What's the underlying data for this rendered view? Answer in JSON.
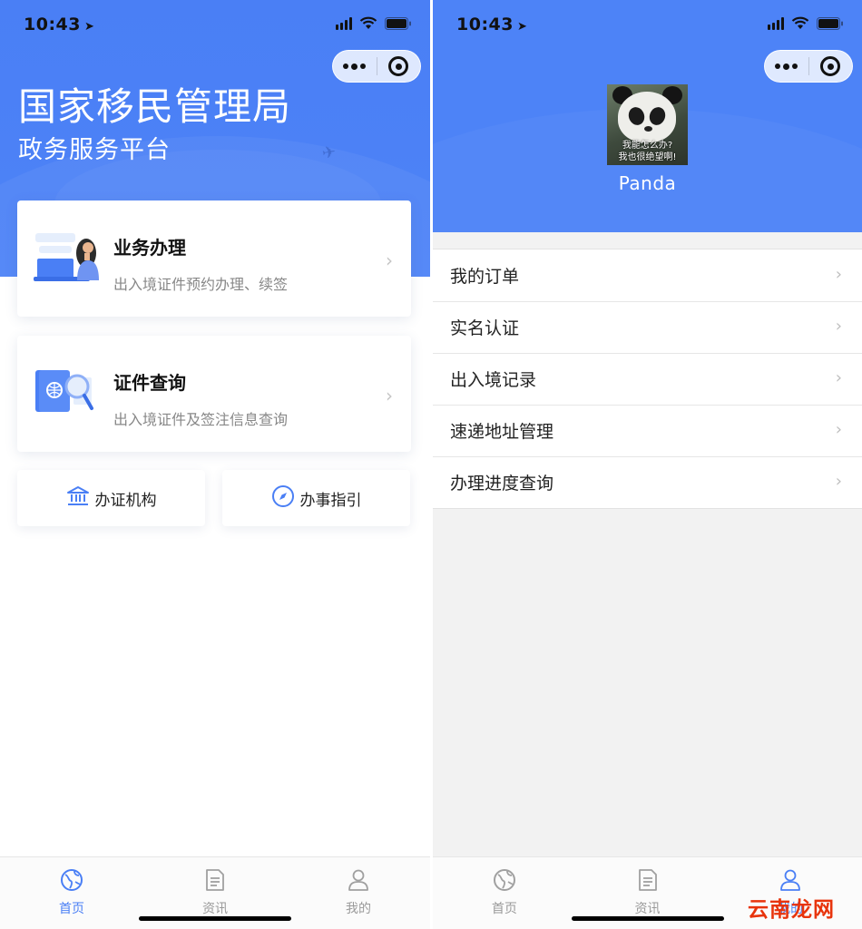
{
  "colors": {
    "brand_blue": "#4d83f7",
    "accent": "#4a7ff5",
    "watermark": "#e8340c"
  },
  "left_screen": {
    "status": {
      "time": "10:43"
    },
    "header": {
      "title": "国家移民管理局",
      "subtitle": "政务服务平台"
    },
    "cards": [
      {
        "title": "业务办理",
        "desc": "出入境证件预约办理、续签",
        "icon": "laptop-woman-illustration"
      },
      {
        "title": "证件查询",
        "desc": "出入境证件及签注信息查询",
        "icon": "passport-search-illustration"
      }
    ],
    "shortcuts": [
      {
        "label": "办证机构",
        "icon": "bank-building-icon"
      },
      {
        "label": "办事指引",
        "icon": "compass-icon"
      }
    ],
    "tabs": [
      {
        "label": "首页",
        "icon": "globe-icon",
        "active": true
      },
      {
        "label": "资讯",
        "icon": "document-icon",
        "active": false
      },
      {
        "label": "我的",
        "icon": "person-icon",
        "active": false
      }
    ]
  },
  "right_screen": {
    "status": {
      "time": "10:43"
    },
    "profile": {
      "name": "Panda",
      "avatar_caption_line1": "我能怎么办?",
      "avatar_caption_line2": "我也很绝望啊!"
    },
    "menu": [
      {
        "label": "我的订单"
      },
      {
        "label": "实名认证"
      },
      {
        "label": "出入境记录"
      },
      {
        "label": "速递地址管理"
      },
      {
        "label": "办理进度查询"
      }
    ],
    "tabs": [
      {
        "label": "首页",
        "icon": "globe-icon",
        "active": false
      },
      {
        "label": "资讯",
        "icon": "document-icon",
        "active": false
      },
      {
        "label": "我的",
        "icon": "person-icon",
        "active": true
      }
    ]
  },
  "watermark": "云南龙网"
}
